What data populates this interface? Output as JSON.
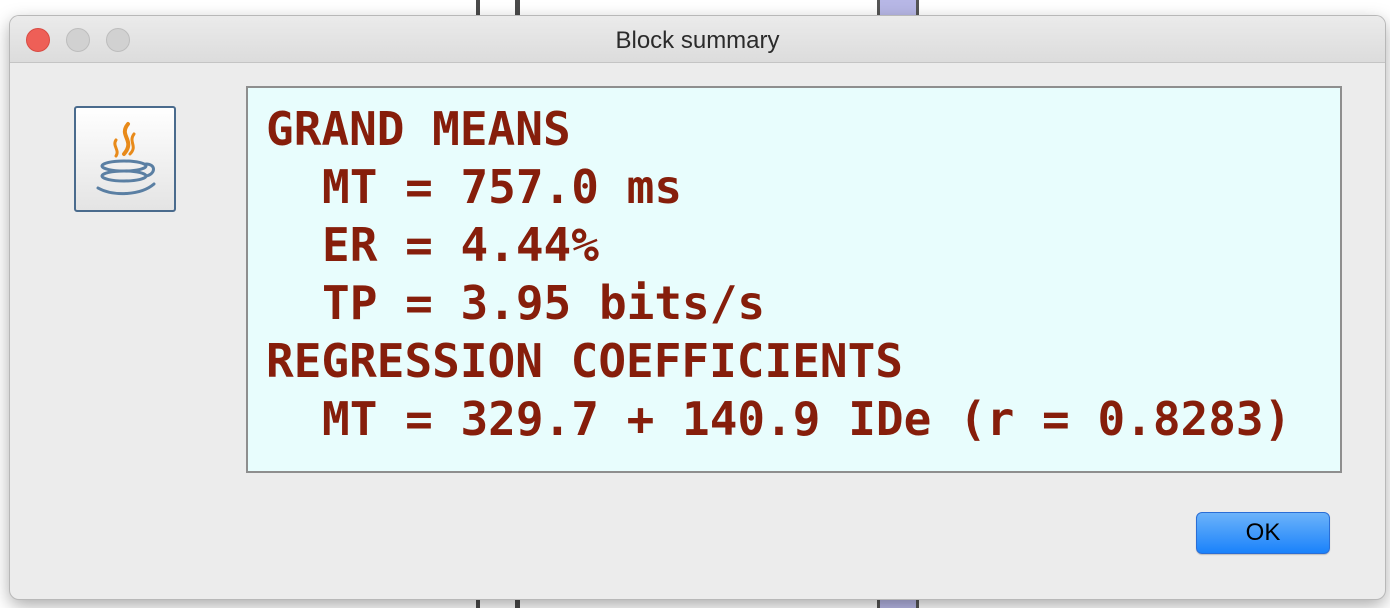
{
  "window": {
    "title": "Block summary"
  },
  "summary": {
    "lines": [
      "GRAND MEANS",
      "MT = 757.0 ms",
      "ER = 4.44%",
      "TP = 3.95 bits/s",
      "REGRESSION COEFFICIENTS",
      "MT = 329.7 + 140.9 IDe (r = 0.8283)"
    ],
    "text_color": "#861e0b",
    "background_color": "#e8fdfd"
  },
  "buttons": {
    "ok_label": "OK"
  },
  "icons": {
    "dialog_icon": "java-icon"
  },
  "colors": {
    "close_button": "#ee5f57",
    "ok_button": "#1a82fb"
  }
}
